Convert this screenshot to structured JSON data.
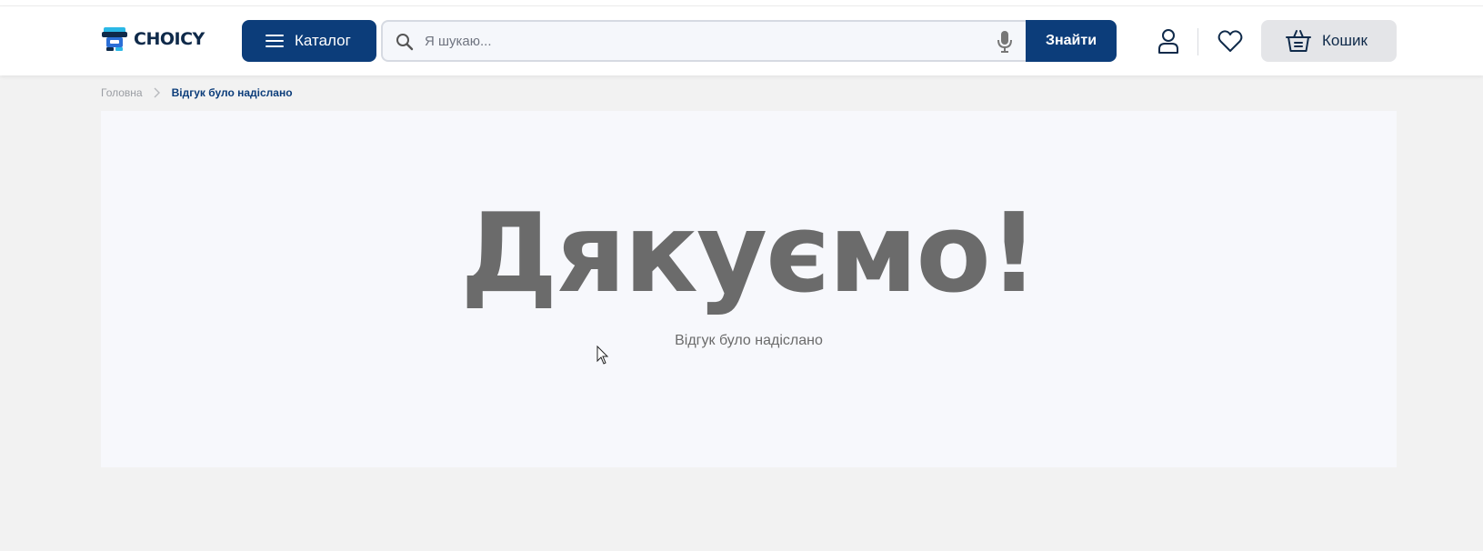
{
  "brand": {
    "name": "CHOICY",
    "primary_color": "#0c3d7a"
  },
  "header": {
    "catalog_label": "Каталог",
    "search": {
      "placeholder": "Я шукаю...",
      "value": ""
    },
    "search_button_label": "Знайти",
    "cart_label": "Кошик"
  },
  "breadcrumb": {
    "home": "Головна",
    "current": "Відгук було надіслано"
  },
  "main": {
    "title": "Дякуємо!",
    "subtitle": "Відгук було надіслано"
  },
  "icons": [
    "menu-icon",
    "search-icon",
    "microphone-icon",
    "user-icon",
    "heart-icon",
    "basket-icon",
    "chevron-right-icon"
  ]
}
